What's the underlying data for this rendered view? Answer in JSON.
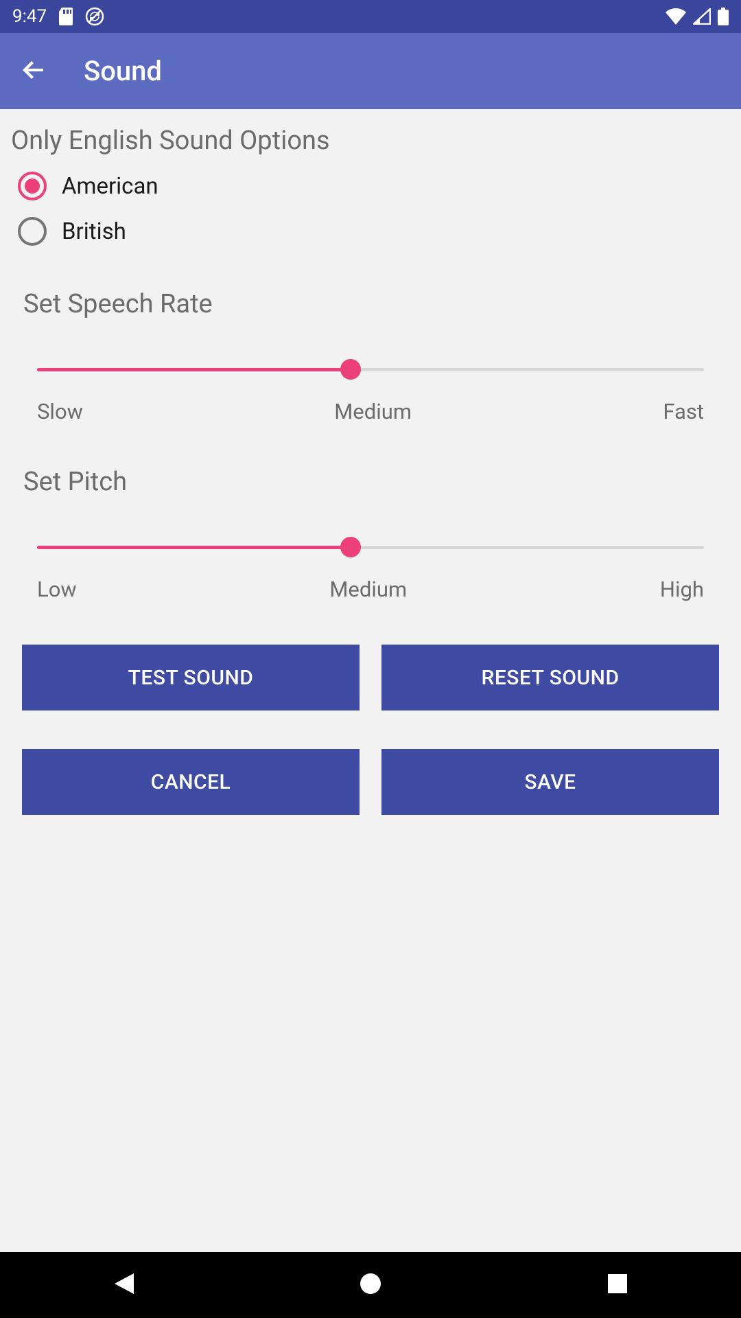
{
  "status": {
    "time": "9:47"
  },
  "appbar": {
    "title": "Sound"
  },
  "sections": {
    "sound_options_title": "Only English Sound Options",
    "speech_rate_title": "Set Speech Rate",
    "pitch_title": "Set Pitch"
  },
  "radios": {
    "american": "American",
    "british": "British",
    "selected": "american"
  },
  "speech_rate": {
    "position_percent": 47,
    "labels": {
      "low": "Slow",
      "mid": "Medium",
      "high": "Fast"
    }
  },
  "pitch": {
    "position_percent": 47,
    "labels": {
      "low": "Low",
      "mid": "Medium",
      "high": "High"
    }
  },
  "buttons": {
    "test": "TEST SOUND",
    "reset": "RESET SOUND",
    "cancel": "CANCEL",
    "save": "SAVE"
  },
  "colors": {
    "primary_dark": "#3a459c",
    "primary": "#5c6bc0",
    "button": "#3f4ba3",
    "accent": "#ec407a"
  }
}
